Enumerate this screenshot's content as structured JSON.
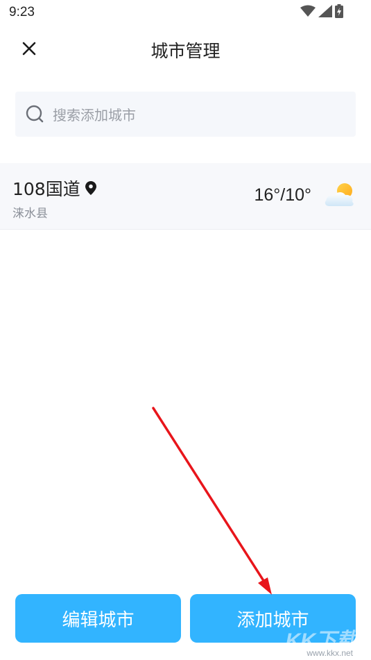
{
  "status_bar": {
    "time": "9:23",
    "icons": [
      "wifi-icon",
      "signal-icon",
      "battery-charging-icon"
    ]
  },
  "header": {
    "title": "城市管理",
    "close_icon": "close-icon"
  },
  "search": {
    "placeholder": "搜索添加城市",
    "icon": "search-icon"
  },
  "cities": [
    {
      "name": "108国道",
      "district": "涞水县",
      "temperature": "16°/10°",
      "is_location": true,
      "weather_icon": "partly-cloudy-icon"
    }
  ],
  "buttons": {
    "edit_label": "编辑城市",
    "add_label": "添加城市"
  },
  "watermark": {
    "logo": "KK下载",
    "url": "www.kkx.net"
  },
  "colors": {
    "primary_button": "#32b4ff",
    "annotation_arrow": "#e8151b",
    "search_background": "#f5f7fb",
    "list_background": "#f7f8fb"
  }
}
